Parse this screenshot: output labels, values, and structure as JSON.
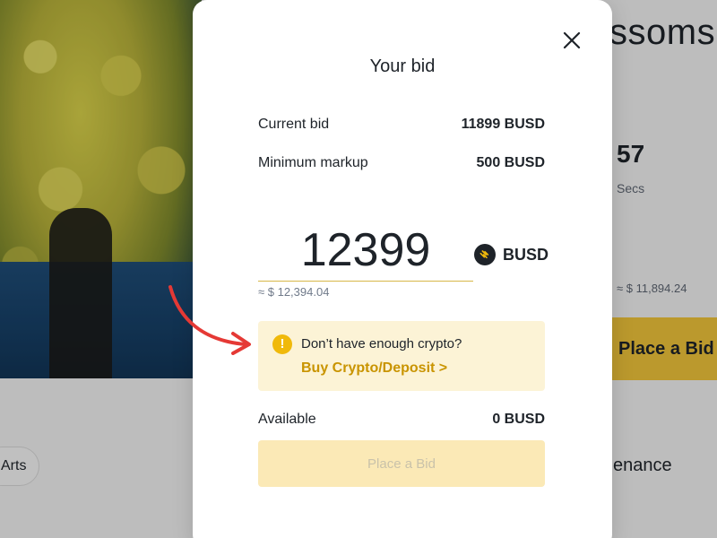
{
  "background": {
    "title_partial": "ssoms",
    "timer_value": "57",
    "timer_unit": "Secs",
    "usd_value": "≈ $ 11,894.24",
    "place_bid_label": "Place a Bid",
    "category_pill": "Arts",
    "tab_partial": "enance"
  },
  "modal": {
    "title": "Your bid",
    "current_bid": {
      "label": "Current bid",
      "value": "11899 BUSD"
    },
    "minimum_markup": {
      "label": "Minimum markup",
      "value": "500 BUSD"
    },
    "bid_input": {
      "value": "12399"
    },
    "currency_label": "BUSD",
    "usd_approx": "≈ $ 12,394.04",
    "notice": {
      "text": "Don’t have enough crypto?",
      "link": "Buy Crypto/Deposit >"
    },
    "available": {
      "label": "Available",
      "value": "0 BUSD"
    },
    "place_bid_label": "Place a Bid"
  },
  "icons": {
    "close": "close-icon",
    "currency": "busd-icon",
    "warning": "warning-icon",
    "annotation": "red-arrow-icon"
  },
  "colors": {
    "accent": "#f0b90b",
    "link": "#c99400",
    "notice_bg": "#fcf3d6",
    "disabled_button_bg": "#fbe9b6",
    "annotation_arrow": "#e53935"
  }
}
